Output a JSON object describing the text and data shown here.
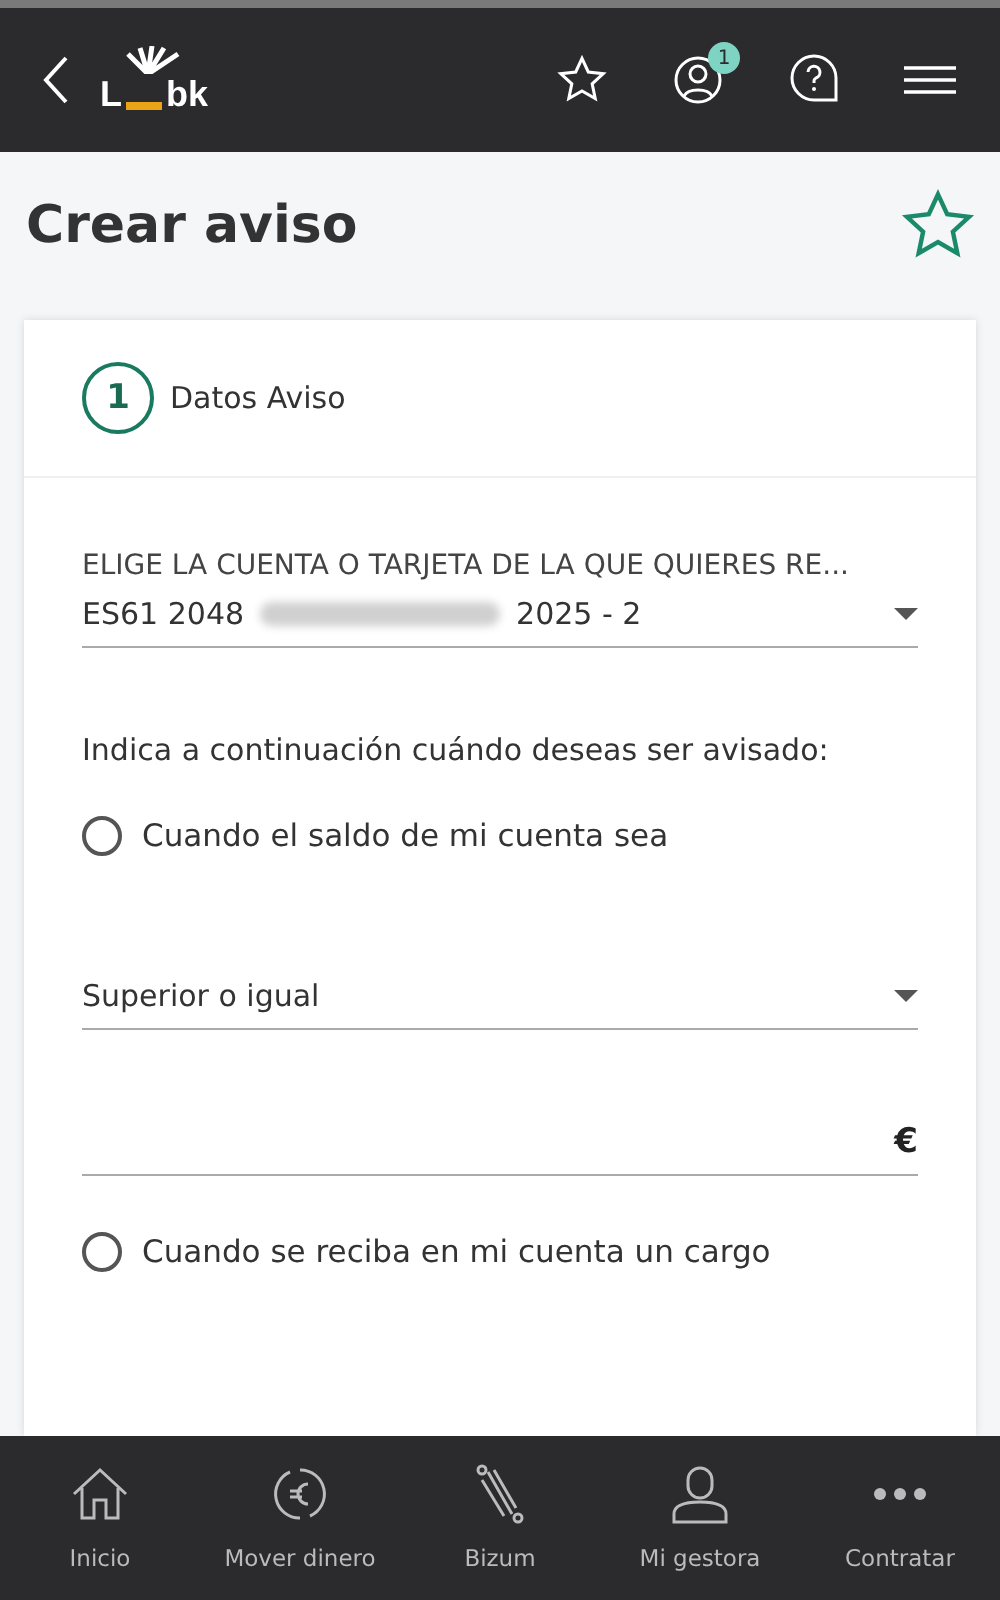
{
  "header": {
    "logo": {
      "left": "L",
      "right": "bk"
    },
    "notification_count": "1"
  },
  "page_title": "Crear aviso",
  "step": {
    "number": "1",
    "label": "Datos Aviso"
  },
  "account_field": {
    "label": "ELIGE LA CUENTA O TARJETA DE LA QUE QUIERES RE...",
    "value_start": "ES61 2048",
    "value_end": "2025 - 2",
    "redacted": true
  },
  "prompt": "Indica a continuación cuándo deseas ser avisado:",
  "options": [
    {
      "kind": "balance",
      "label": "Cuando el saldo de mi cuenta sea",
      "selected": false,
      "condition": "Superior o igual",
      "currency": "€"
    },
    {
      "kind": "charge",
      "label": "Cuando se reciba en mi cuenta un cargo",
      "selected": false
    }
  ],
  "bottom_nav": [
    {
      "kind": "home",
      "label": "Inicio"
    },
    {
      "kind": "money",
      "label": "Mover dinero"
    },
    {
      "kind": "bizum",
      "label": "Bizum"
    },
    {
      "kind": "manager",
      "label": "Mi gestora"
    },
    {
      "kind": "more",
      "label": "Contratar"
    }
  ]
}
